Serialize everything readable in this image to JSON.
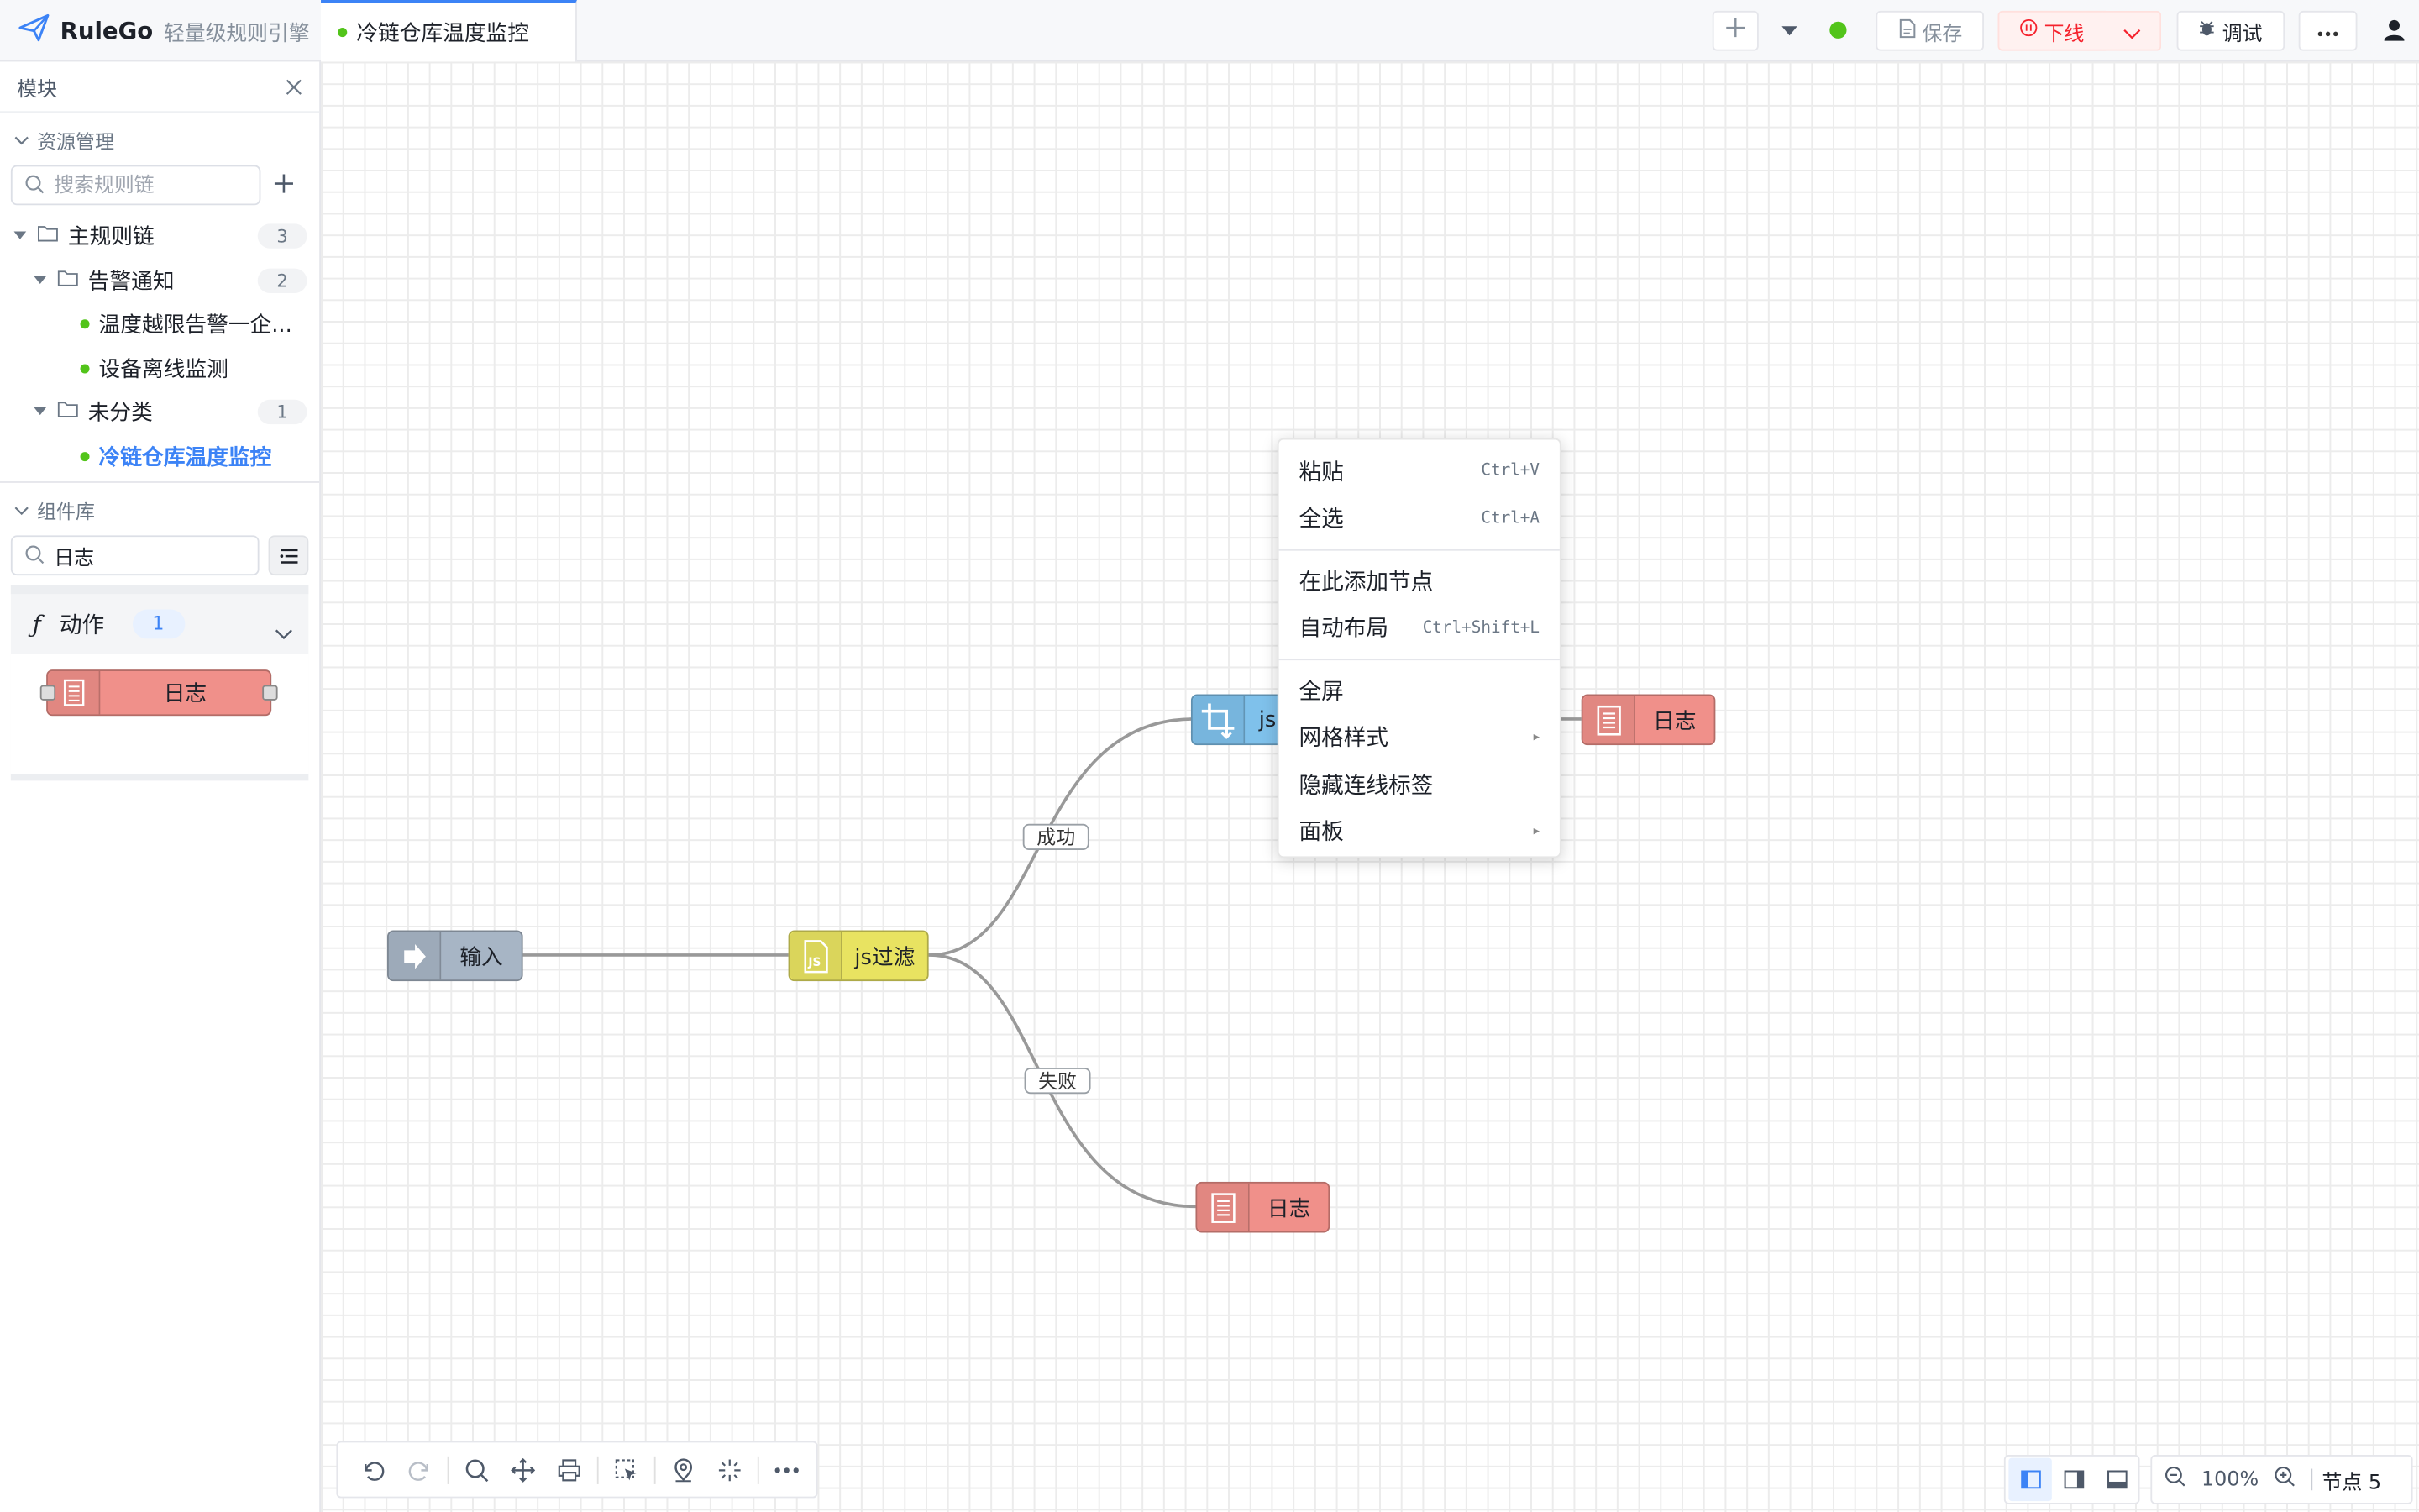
{
  "header": {
    "brand_name": "RuleGo",
    "brand_subtitle": "轻量级规则引擎",
    "tab_title": "冷链仓库温度监控",
    "save_label": "保存",
    "offline_label": "下线",
    "debug_label": "调试"
  },
  "sidebar": {
    "header_title": "模块",
    "resource_section": "资源管理",
    "search_placeholder": "搜索规则链",
    "tree": [
      {
        "label": "主规则链",
        "count": "3"
      },
      {
        "label": "告警通知",
        "count": "2"
      },
      {
        "label": "温度越限告警一企..."
      },
      {
        "label": "设备离线监测"
      },
      {
        "label": "未分类",
        "count": "1"
      },
      {
        "label": "冷链仓库温度监控"
      }
    ],
    "component_section": "组件库",
    "component_search_value": "日志",
    "group": {
      "name": "动作",
      "count": "1",
      "items": [
        "日志"
      ]
    }
  },
  "canvas": {
    "nodes": {
      "input": "输入",
      "jsfilter": "js过滤",
      "jsnode": "js",
      "log_top": "日志",
      "log_bottom": "日志"
    },
    "edges": {
      "success": "成功",
      "failure": "失败"
    }
  },
  "context_menu": {
    "items": [
      {
        "label": "粘贴",
        "shortcut": "Ctrl+V"
      },
      {
        "label": "全选",
        "shortcut": "Ctrl+A"
      },
      {
        "label": "在此添加节点"
      },
      {
        "label": "自动布局",
        "shortcut": "Ctrl+Shift+L"
      },
      {
        "label": "全屏"
      },
      {
        "label": "网格样式"
      },
      {
        "label": "隐藏连线标签"
      },
      {
        "label": "面板"
      }
    ]
  },
  "statusbar": {
    "zoom": "100%",
    "node_count": "节点 5"
  }
}
